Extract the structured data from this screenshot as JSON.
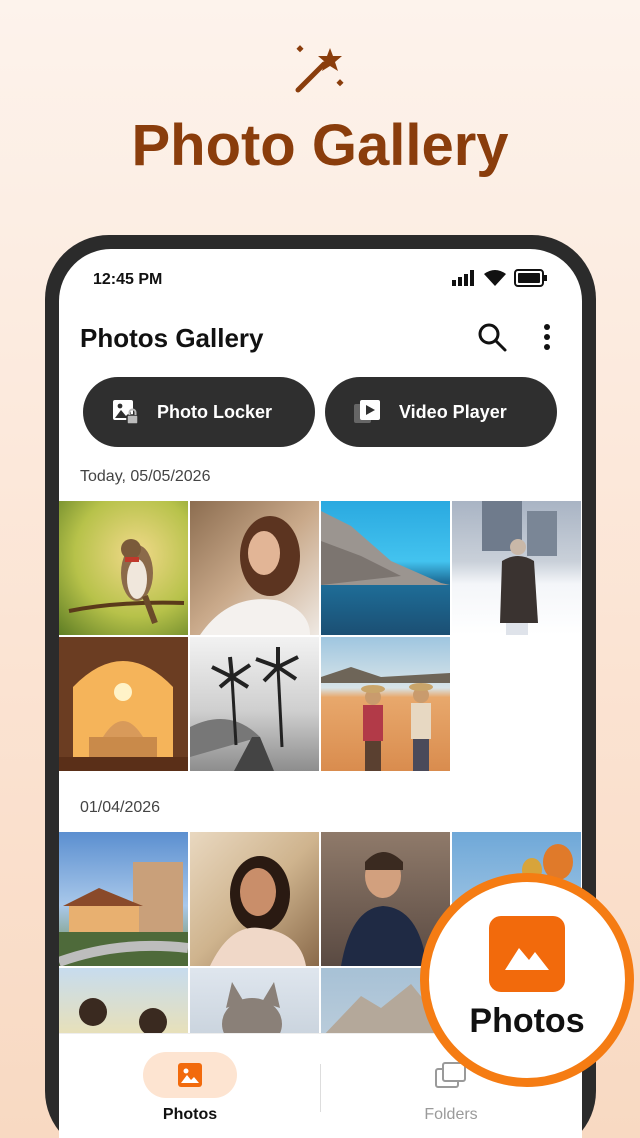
{
  "promo": {
    "title": "Photo Gallery",
    "icon": "magic-wand-icon"
  },
  "status_bar": {
    "time": "12:45 PM"
  },
  "app": {
    "title": "Photos Gallery"
  },
  "actions": {
    "photo_locker": "Photo Locker",
    "video_player": "Video Player"
  },
  "sections": [
    {
      "date": "Today, 05/05/2026",
      "photos": [
        "bird-on-branch",
        "woman-smiling",
        "sea-cliff",
        "woman-in-snow",
        "taj-mahal-arch",
        "palm-trees-road",
        "desert-travelers"
      ]
    },
    {
      "date": "01/04/2026",
      "photos": [
        "resort-hotel",
        "woman-selfie-train",
        "man-jacket",
        "hot-air-balloons",
        "field-people",
        "kitten",
        "mountain"
      ]
    }
  ],
  "nav": {
    "photos": "Photos",
    "folders": "Folders"
  },
  "callout": {
    "label": "Photos"
  },
  "colors": {
    "accent": "#f57c13",
    "title": "#8a3d0c",
    "pill": "#2f2f2f"
  }
}
